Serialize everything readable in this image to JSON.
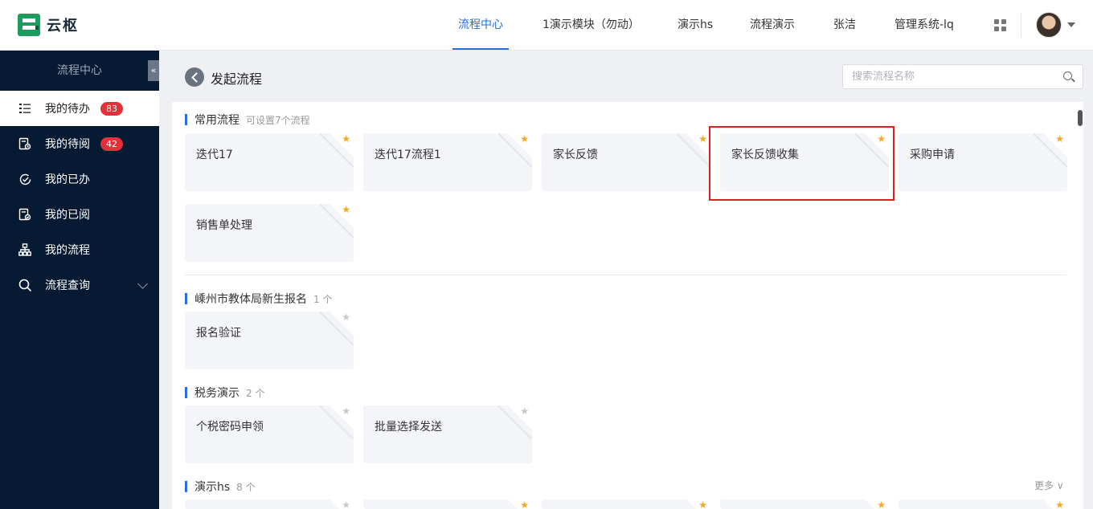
{
  "app": {
    "logo_text": "云枢"
  },
  "topnav": {
    "items": [
      {
        "label": "流程中心",
        "active": true
      },
      {
        "label": "1演示模块（勿动）",
        "active": false
      },
      {
        "label": "演示hs",
        "active": false
      },
      {
        "label": "流程演示",
        "active": false
      },
      {
        "label": "张洁",
        "active": false
      },
      {
        "label": "管理系统-lq",
        "active": false
      }
    ]
  },
  "sidebar": {
    "title": "流程中心",
    "collapse_glyph": "«",
    "items": [
      {
        "label": "我的待办",
        "badge": "83",
        "icon": "todo-list-icon",
        "active": true
      },
      {
        "label": "我的待阅",
        "badge": "42",
        "icon": "to-read-icon",
        "active": false
      },
      {
        "label": "我的已办",
        "badge": "",
        "icon": "done-icon",
        "active": false
      },
      {
        "label": "我的已阅",
        "badge": "",
        "icon": "read-icon",
        "active": false
      },
      {
        "label": "我的流程",
        "badge": "",
        "icon": "workflow-tree-icon",
        "active": false
      },
      {
        "label": "流程查询",
        "badge": "",
        "icon": "search-icon",
        "active": false
      }
    ]
  },
  "header": {
    "title": "发起流程",
    "search_placeholder": "搜索流程名称"
  },
  "sections": [
    {
      "title": "常用流程",
      "subtitle": "可设置7个流程",
      "cards": [
        {
          "label": "迭代17",
          "starred": true
        },
        {
          "label": "迭代17流程1",
          "starred": true
        },
        {
          "label": "家长反馈",
          "starred": true
        },
        {
          "label": "家长反馈收集",
          "starred": true
        },
        {
          "label": "采购申请",
          "starred": true
        },
        {
          "label": "销售单处理",
          "starred": true
        }
      ]
    },
    {
      "title": "嵊州市教体局新生报名",
      "subtitle": "1 个",
      "cards": [
        {
          "label": "报名验证",
          "starred": false
        }
      ]
    },
    {
      "title": "税务演示",
      "subtitle": "2 个",
      "cards": [
        {
          "label": "个税密码申领",
          "starred": false
        },
        {
          "label": "批量选择发送",
          "starred": false
        }
      ]
    },
    {
      "title": "演示hs",
      "subtitle": "8 个",
      "more": "更多"
    }
  ],
  "colors": {
    "accent": "#2a6fdb",
    "sidebar_bg": "#071a33",
    "badge": "#e2313a",
    "star": "#f5a623",
    "highlight": "#e02020"
  }
}
